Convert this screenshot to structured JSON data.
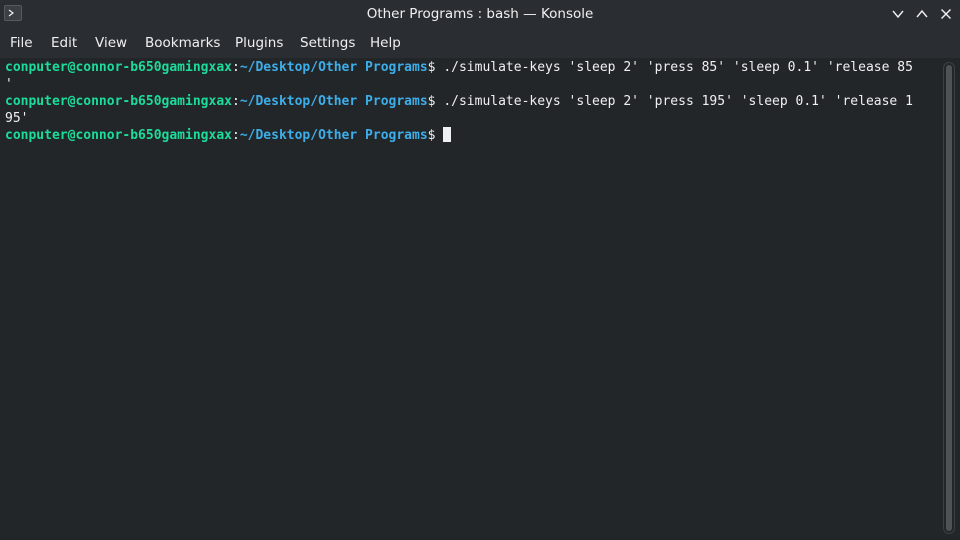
{
  "window": {
    "title": "Other Programs : bash — Konsole"
  },
  "menu": {
    "items": [
      "File",
      "Edit",
      "View",
      "Bookmarks",
      "Plugins",
      "Settings",
      "Help"
    ]
  },
  "terminal": {
    "lines": [
      {
        "user": "conputer@connor-b650gamingxax",
        "sep": ":",
        "path": "~/Desktop/Other Programs",
        "dollar": "$ ",
        "cmd": "./simulate-keys 'sleep 2' 'press 85' 'sleep 0.1' 'release 85",
        "wrap": "'"
      },
      {
        "user": "conputer@connor-b650gamingxax",
        "sep": ":",
        "path": "~/Desktop/Other Programs",
        "dollar": "$ ",
        "cmd": "./simulate-keys 'sleep 2' 'press 195' 'sleep 0.1' 'release 1",
        "wrap": "95'"
      },
      {
        "user": "conputer@connor-b650gamingxax",
        "sep": ":",
        "path": "~/Desktop/Other Programs",
        "dollar": "$ ",
        "cmd": ""
      }
    ]
  },
  "icons": {
    "app": "terminal-icon",
    "minimize": "chevron-down-icon",
    "maximize": "chevron-up-icon",
    "close": "close-icon"
  },
  "colors": {
    "background": "#232629",
    "chrome": "#2a2e32",
    "prompt_user": "#1cdc9a",
    "prompt_path": "#3daee9",
    "text": "#eff0f1"
  }
}
